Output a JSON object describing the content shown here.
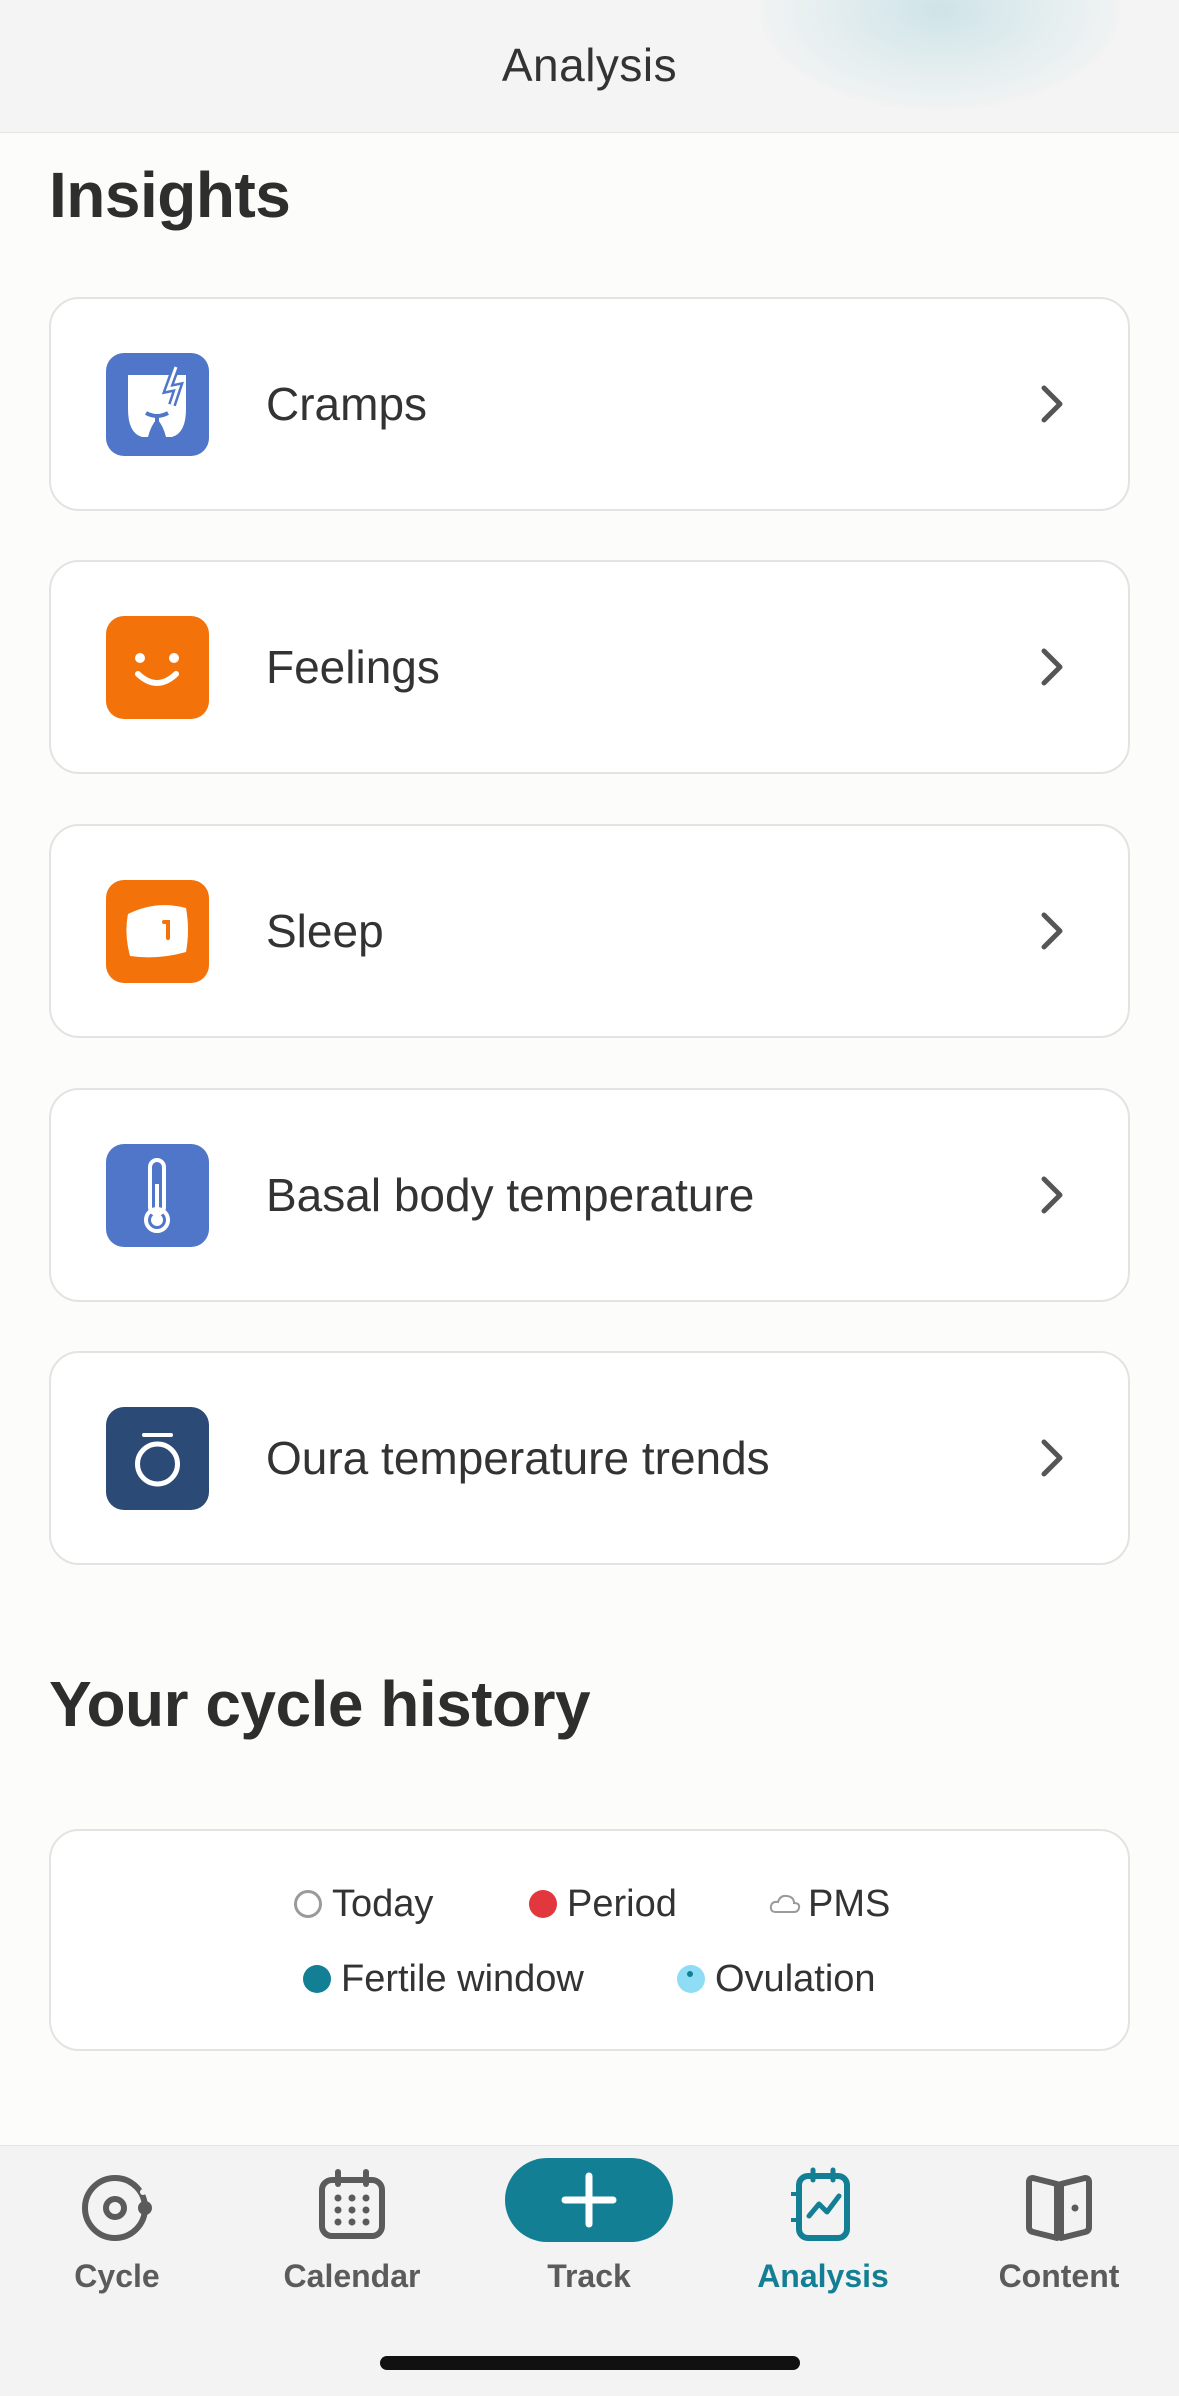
{
  "header": {
    "title": "Analysis"
  },
  "insights": {
    "title": "Insights",
    "items": [
      {
        "label": "Cramps",
        "icon": "cramps-icon",
        "color": "#4f76c8"
      },
      {
        "label": "Feelings",
        "icon": "smile-icon",
        "color": "#f3720a"
      },
      {
        "label": "Sleep",
        "icon": "pillow-icon",
        "color": "#f3720a"
      },
      {
        "label": "Basal body temperature",
        "icon": "thermometer-icon",
        "color": "#4f76c8"
      },
      {
        "label": "Oura temperature trends",
        "icon": "oura-ring-icon",
        "color": "#2c4a76"
      }
    ]
  },
  "cycle_history": {
    "title": "Your cycle history",
    "legend": {
      "today": "Today",
      "period": "Period",
      "pms": "PMS",
      "fertile_window": "Fertile window",
      "ovulation": "Ovulation"
    },
    "colors": {
      "period": "#e2373d",
      "fertile": "#137f94",
      "ovulation": "#8fdcf5"
    }
  },
  "nav": {
    "cycle": "Cycle",
    "calendar": "Calendar",
    "track": "Track",
    "analysis": "Analysis",
    "content": "Content",
    "active": "analysis",
    "accent": "#137f94"
  }
}
